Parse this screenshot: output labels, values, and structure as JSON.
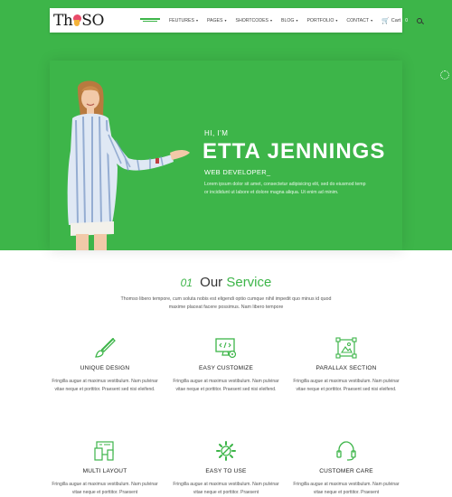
{
  "brand": {
    "logo_left": "Th",
    "logo_right": "SO"
  },
  "nav": {
    "items": [
      {
        "label": "FEUTURES",
        "caret": "▾"
      },
      {
        "label": "PAGES",
        "caret": "▾"
      },
      {
        "label": "SHORTCODES",
        "caret": "▾"
      },
      {
        "label": "BLOG",
        "caret": "▾"
      },
      {
        "label": "PORTFOLIO",
        "caret": "▾"
      },
      {
        "label": "CONTACT",
        "caret": "▾"
      }
    ],
    "cart_label": "Cart",
    "cart_count": "0"
  },
  "hero": {
    "greeting": "HI, I'M",
    "name": "ETTA JENNINGS",
    "role": "WEB DEVELOPER_",
    "description": "Lorem ipsum dolor sit amet, consectetur adipisicing elit, sed do eiusmod temp or incididunt ut labore et dolore magna aliqua. Ut enim ad minim."
  },
  "services": {
    "number": "01",
    "title_plain": "Our",
    "title_accent": "Service",
    "intro": "Thomso libero tempore, cum soluta nobis est eligendi optio cumque nihil impedit quo minus id quod maxime placeat facere possimus. Nam libero tempore",
    "items": [
      {
        "icon": "brush-icon",
        "title": "UNIQUE DESIGN",
        "text": "Fringilla augue at maximus vestibulum. Nam pulvinar vitae neque et porttitor. Praesent sed nisi eleifend."
      },
      {
        "icon": "code-monitor-icon",
        "title": "EASY CUSTOMIZE",
        "text": "Fringilla augue at maximus vestibulum. Nam pulvinar vitae neque et porttitor. Praesent sed nisi eleifend."
      },
      {
        "icon": "image-frame-icon",
        "title": "PARALLAX SECTION",
        "text": "Fringilla augue at maximus vestibulum. Nam pulvinar vitae neque et porttitor. Praesent sed nisi eleifend."
      },
      {
        "icon": "multi-device-icon",
        "title": "MULTI LAYOUT",
        "text": "Fringilla augue at maximus vestibulum. Nam pulvinar vitae neque et porttitor. Praesent"
      },
      {
        "icon": "gear-wrench-icon",
        "title": "EASY TO USE",
        "text": "Fringilla augue at maximus vestibulum. Nam pulvinar vitae neque et porttitor. Praesent"
      },
      {
        "icon": "headset-icon",
        "title": "CUSTOMER CARE",
        "text": "Fringilla augue at maximus vestibulum. Nam pulvinar vitae neque et porttitor. Praesent"
      }
    ]
  },
  "colors": {
    "accent": "#3db549",
    "text": "#333333"
  }
}
